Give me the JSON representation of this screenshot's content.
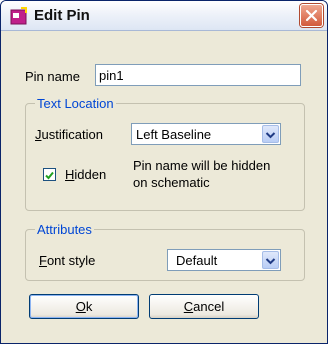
{
  "window": {
    "title": "Edit Pin"
  },
  "pin_name": {
    "label": "Pin name",
    "value": "pin1"
  },
  "text_location": {
    "legend": "Text Location",
    "justification": {
      "label_mnemonic": "J",
      "label_rest": "ustification",
      "value": "Left Baseline"
    },
    "hidden": {
      "checked": true,
      "label_mnemonic": "H",
      "label_rest": "idden"
    },
    "note_line1": "Pin name will be hidden",
    "note_line2": "on schematic"
  },
  "attributes": {
    "legend": "Attributes",
    "font_style": {
      "label_mnemonic": "F",
      "label_rest": "ont style",
      "value": "Default"
    }
  },
  "buttons": {
    "ok": {
      "mnemonic": "O",
      "rest": "k"
    },
    "cancel": {
      "mnemonic": "C",
      "rest": "ancel"
    }
  },
  "colors": {
    "group_legend": "#0046d5",
    "close_button": "#d25a3c",
    "window_bg": "#ece9d8"
  }
}
